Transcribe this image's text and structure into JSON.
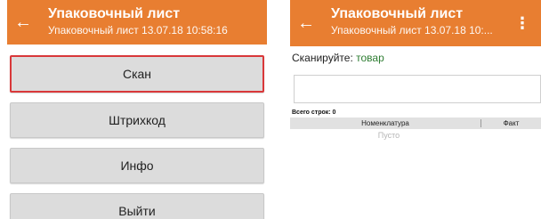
{
  "left_screen": {
    "title": "Упаковочный лист",
    "subtitle": "Упаковочный лист 13.07.18 10:58:16",
    "menu": [
      "Скан",
      "Штрихкод",
      "Инфо",
      "Выйти"
    ]
  },
  "right_screen": {
    "title": "Упаковочный лист",
    "subtitle": "Упаковочный лист 13.07.18 10:...",
    "prompt_label": "Сканируйте:",
    "prompt_value": "товар",
    "rows_total": "Всего строк: 0",
    "columns": [
      "Номенклатура",
      "Факт"
    ],
    "empty_text": "Пусто"
  },
  "colors": {
    "appbar": "#e87e31",
    "selected_border": "#d9383a",
    "prompt_value": "#2e7d32"
  },
  "icons": {
    "back": "arrow-back-icon",
    "menu": "more-vert-icon"
  }
}
